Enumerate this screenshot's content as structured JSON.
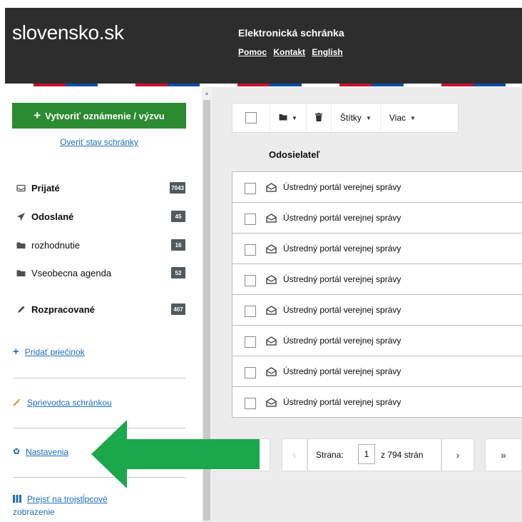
{
  "header": {
    "logo": "slovensko.sk",
    "title": "Elektronická schránka",
    "links": [
      "Pomoc",
      "Kontakt",
      "English"
    ]
  },
  "sidebar": {
    "create_button": "Vytvoriť oznámenie / výzvu",
    "verify_link": "Overiť stav schránky",
    "folders": [
      {
        "label": "Prijaté",
        "count": "7043",
        "icon": "inbox-icon"
      },
      {
        "label": "Odoslané",
        "count": "45",
        "icon": "paper-plane-icon"
      },
      {
        "label": "rozhodnutie",
        "count": "16",
        "icon": "folder-icon"
      },
      {
        "label": "Vseobecna agenda",
        "count": "52",
        "icon": "folder-icon"
      },
      {
        "label": "Rozpracované",
        "count": "407",
        "icon": "pencil-icon"
      }
    ],
    "add_folder": "Pridať priečinok",
    "guide": "Sprievodca schránkou",
    "settings": "Nastavenia",
    "three_column_line1": "Prejsť na trojstĺpcové",
    "three_column_line2": "zobrazenie"
  },
  "toolbar": {
    "labels_button": "Štítky",
    "more_button": "Viac"
  },
  "table": {
    "column_sender": "Odosielateľ",
    "rows": [
      "Ústredný portál verejnej správy",
      "Ústredný portál verejnej správy",
      "Ústredný portál verejnej správy",
      "Ústredný portál verejnej správy",
      "Ústredný portál verejnej správy",
      "Ústredný portál verejnej správy",
      "Ústredný portál verejnej správy",
      "Ústredný portál verejnej správy"
    ]
  },
  "pager": {
    "page_label": "Strana:",
    "current_page": "1",
    "total_text": "z 794 strán",
    "prev": "‹",
    "next": "›",
    "last": "»"
  },
  "colors": {
    "create_button": "#2c8a31",
    "arrow": "#1aa84a",
    "header": "#2d2d2d",
    "link": "#1d70b8"
  }
}
